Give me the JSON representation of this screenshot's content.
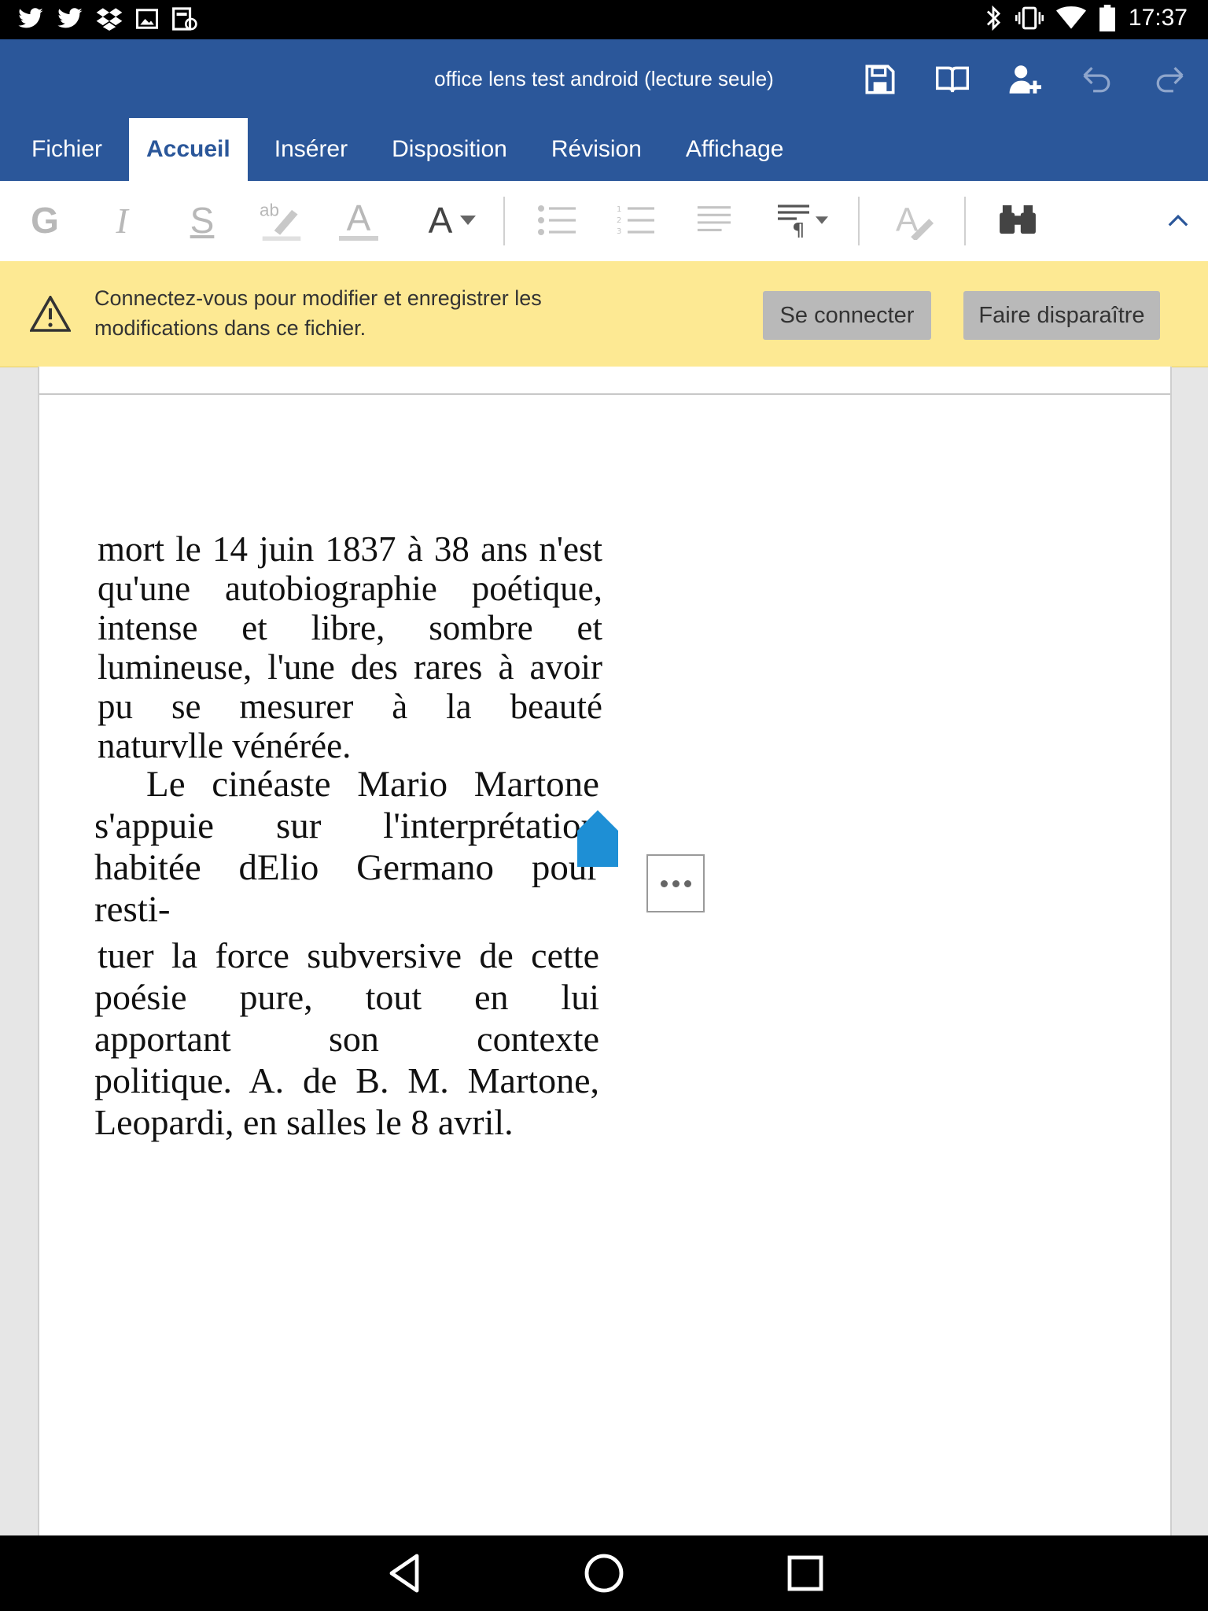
{
  "status_bar": {
    "time": "17:37",
    "left_icons": [
      "twitter-icon",
      "twitter-icon",
      "dropbox-icon",
      "image-icon",
      "sync-icon"
    ],
    "right_icons": [
      "bluetooth-icon",
      "vibrate-icon",
      "wifi-icon",
      "battery-icon"
    ]
  },
  "titlebar": {
    "document_title": "office lens test android (lecture seule)",
    "actions": [
      "save-icon",
      "read-mode-icon",
      "share-icon",
      "undo-icon",
      "redo-icon"
    ]
  },
  "tabs": [
    {
      "label": "Fichier",
      "active": false
    },
    {
      "label": "Accueil",
      "active": true
    },
    {
      "label": "Insérer",
      "active": false
    },
    {
      "label": "Disposition",
      "active": false
    },
    {
      "label": "Révision",
      "active": false
    },
    {
      "label": "Affichage",
      "active": false
    }
  ],
  "ribbon": {
    "bold_label": "G",
    "italic_label": "I",
    "underline_label": "S",
    "highlight_label": "ab",
    "font_color_label": "A",
    "font_size_label": "A"
  },
  "notice": {
    "message": "Connectez-vous pour modifier et enregistrer les modifications dans ce fichier.",
    "connect_button": "Se connecter",
    "dismiss_button": "Faire disparaître"
  },
  "document": {
    "paragraph1": [
      "mort le 14 juin 1837 à 38 ans n'est",
      "qu'une autobiographie poétique,",
      "intense et libre, sombre et",
      "lumineuse, l'une des rares à avoir",
      "pu se mesurer à la beauté",
      "naturvlle vénérée."
    ],
    "paragraph2": [
      "Le cinéaste Mario Martone",
      "s'appuie sur l'interprétation",
      "habitée dElio Germano pour",
      "resti-"
    ],
    "paragraph3": [
      "tuer la force subversive de cette",
      "poésie pure, tout en lui",
      "apportant son contexte",
      "politique. A. de B. M. Martone,",
      "Leopardi, en salles le 8 avril."
    ]
  },
  "colors": {
    "title_bar": "#2b579a",
    "notice_bg": "#fde993",
    "cursor_handle": "#1e8fd5"
  }
}
